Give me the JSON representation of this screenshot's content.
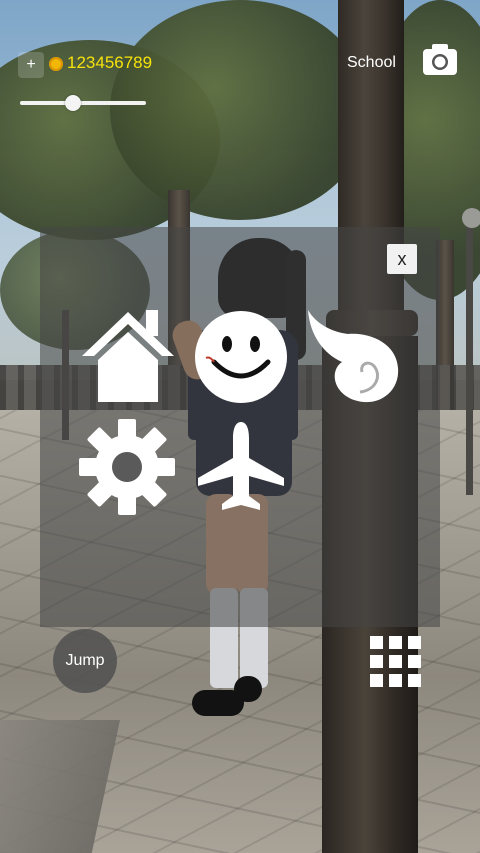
{
  "hud": {
    "plus_label": "+",
    "coins": "123456789",
    "coin_color": "#f6e20a",
    "location": "School",
    "camera_icon": "camera-icon",
    "view_slider": {
      "value_fraction": 0.42
    }
  },
  "menu": {
    "close_label": "x",
    "items": [
      {
        "icon": "home-icon"
      },
      {
        "icon": "smiley-face-icon"
      },
      {
        "icon": "wing-icon"
      },
      {
        "icon": "gear-icon"
      },
      {
        "icon": "airplane-icon"
      }
    ]
  },
  "controls": {
    "jump_label": "Jump",
    "grid_icon": "grid-menu-icon"
  }
}
